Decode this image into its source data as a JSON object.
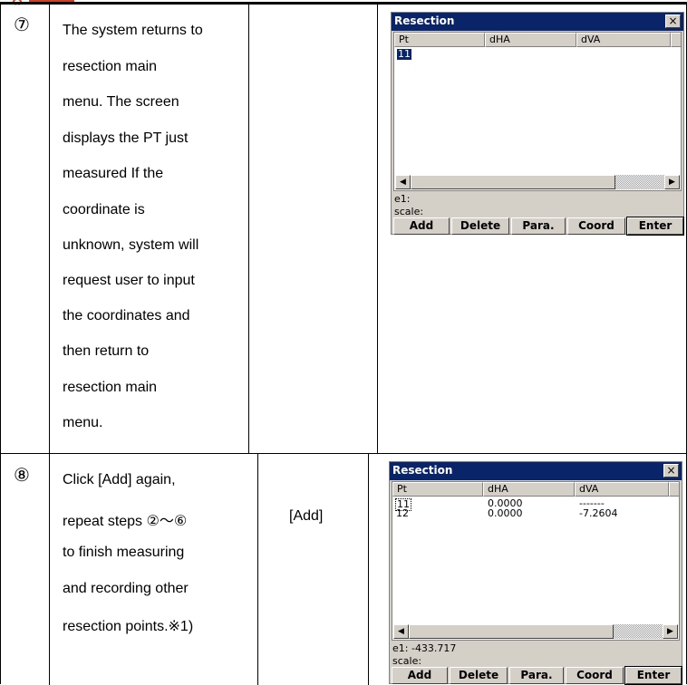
{
  "steps": [
    {
      "number": "⑦",
      "lines": [
        "The system returns to",
        "resection main",
        "menu. The screen",
        "displays the PT just",
        "measured If the",
        "coordinate is",
        "unknown, system will",
        "request user to input",
        "the coordinates and",
        "then return to",
        "resection main",
        "menu."
      ],
      "key": ""
    },
    {
      "number": "⑧",
      "lines": [
        "Click [Add] again,",
        "repeat steps ②～⑥",
        "to finish measuring",
        "and recording other",
        "resection points.※1)"
      ],
      "key": "[Add]"
    }
  ],
  "dialogs": [
    {
      "title": "Resection",
      "close": "×",
      "columns": [
        "Pt",
        "dHA",
        "dVA"
      ],
      "rows": [
        {
          "pt": "11",
          "dha": "",
          "dva": ""
        }
      ],
      "e1": "e1:",
      "scale": "scale:",
      "buttons": [
        "Add",
        "Delete",
        "Para.",
        "Coord",
        "Enter"
      ]
    },
    {
      "title": "Resection",
      "close": "×",
      "columns": [
        "Pt",
        "dHA",
        "dVA"
      ],
      "rows": [
        {
          "pt": "11",
          "dha": "0.0000",
          "dva": "-------"
        },
        {
          "pt": "12",
          "dha": "0.0000",
          "dva": "-7.2604"
        }
      ],
      "e1": "e1: -433.717",
      "scale": "scale:",
      "buttons": [
        "Add",
        "Delete",
        "Para.",
        "Coord",
        "Enter"
      ]
    }
  ],
  "scroll_arrows": {
    "left": "◀",
    "right": "▶"
  },
  "colors": {
    "titlebar": "#0a246a",
    "dialog_bg": "#d4d0c8",
    "accent": "#c8442a"
  }
}
